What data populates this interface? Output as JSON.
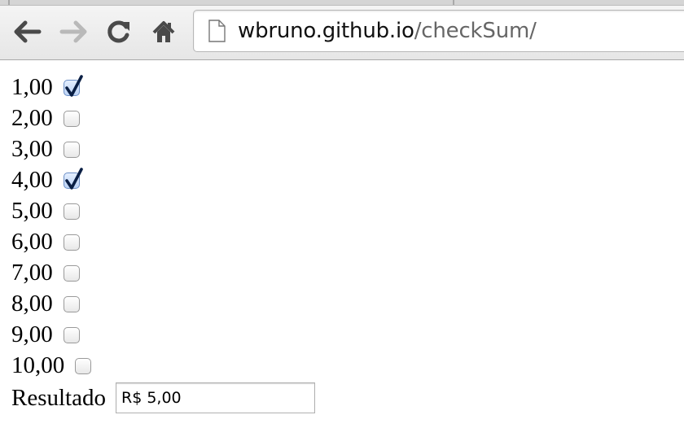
{
  "browser": {
    "url_host": "wbruno.github.io",
    "url_path": "/checkSum/",
    "icons": [
      "back-icon",
      "forward-icon",
      "reload-icon",
      "home-icon",
      "page-icon"
    ]
  },
  "items": [
    {
      "label": "1,00",
      "checked": true
    },
    {
      "label": "2,00",
      "checked": false
    },
    {
      "label": "3,00",
      "checked": false
    },
    {
      "label": "4,00",
      "checked": true
    },
    {
      "label": "5,00",
      "checked": false
    },
    {
      "label": "6,00",
      "checked": false
    },
    {
      "label": "7,00",
      "checked": false
    },
    {
      "label": "8,00",
      "checked": false
    },
    {
      "label": "9,00",
      "checked": false
    },
    {
      "label": "10,00",
      "checked": false
    }
  ],
  "result": {
    "label": "Resultado",
    "value": "R$ 5,00"
  },
  "colors": {
    "checkmark": "#0a1f44",
    "checked_fill": "#bcd3f5"
  }
}
